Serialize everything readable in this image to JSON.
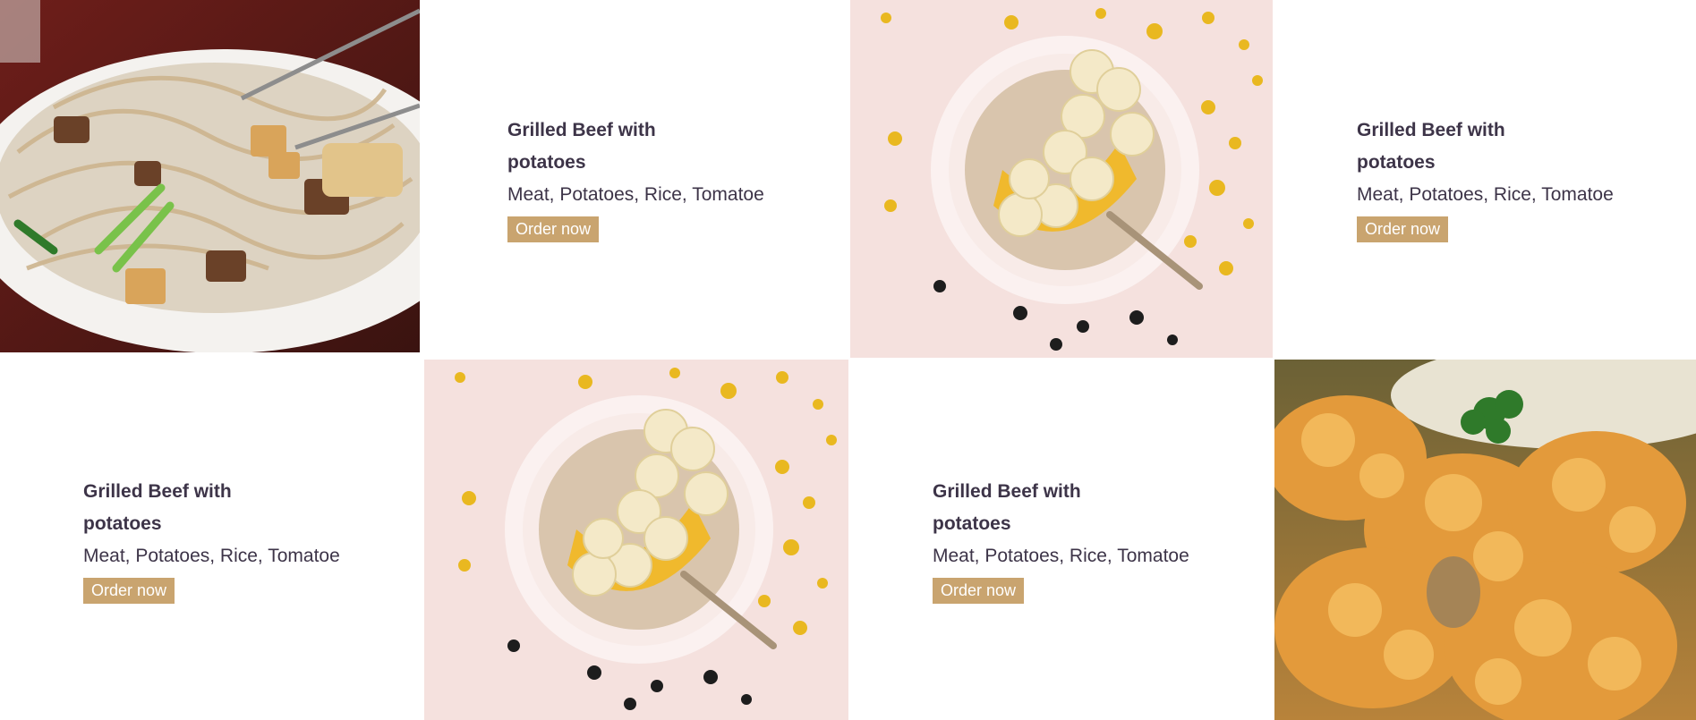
{
  "menu": {
    "items": [
      {
        "title_line1": "Grilled Beef with",
        "title_line2": "potatoes",
        "ingredients": "Meat, Potatoes, Rice, Tomatoe",
        "button": "Order now"
      },
      {
        "title_line1": "Grilled Beef with",
        "title_line2": "potatoes",
        "ingredients": "Meat, Potatoes, Rice, Tomatoe",
        "button": "Order now"
      },
      {
        "title_line1": "Grilled Beef with",
        "title_line2": "potatoes",
        "ingredients": "Meat, Potatoes, Rice, Tomatoe",
        "button": "Order now"
      },
      {
        "title_line1": "Grilled Beef with",
        "title_line2": "potatoes",
        "ingredients": "Meat, Potatoes, Rice, Tomatoe",
        "button": "Order now"
      }
    ],
    "images": [
      {
        "icon": "noodles-dish-photo"
      },
      {
        "icon": "banana-bowl-photo"
      },
      {
        "icon": "banana-bowl-photo"
      },
      {
        "icon": "fried-chicken-photo"
      }
    ]
  },
  "colors": {
    "text": "#3d3448",
    "button_bg": "#c9a46f",
    "button_text": "#ffffff",
    "confetti": "#e9b820",
    "bowl_bg": "#f5e1de"
  }
}
